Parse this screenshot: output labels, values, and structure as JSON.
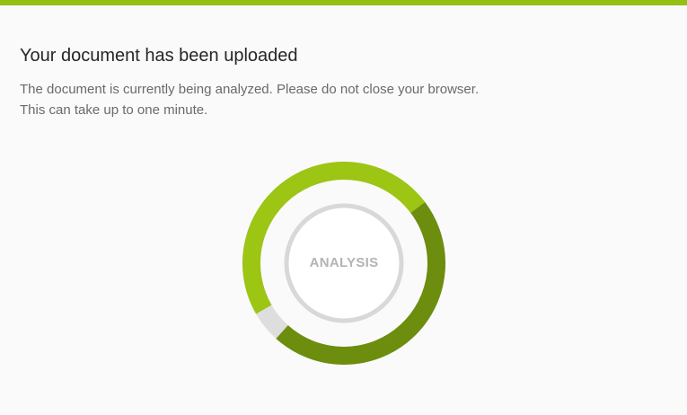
{
  "accent_color": "#94bf13",
  "header": {
    "title": "Your document has been uploaded"
  },
  "message": {
    "line1": "The document is currently being analyzed. Please do not close your browser.",
    "line2": "This can take up to one minute."
  },
  "progress": {
    "label": "ANALYSIS",
    "fraction_complete": 0.95,
    "colors": {
      "segment_light": "#9cc514",
      "segment_dark": "#6c8d0d",
      "remaining": "#dedede",
      "inner_ring": "#d8d8d8",
      "label": "#b4b4b4"
    }
  }
}
